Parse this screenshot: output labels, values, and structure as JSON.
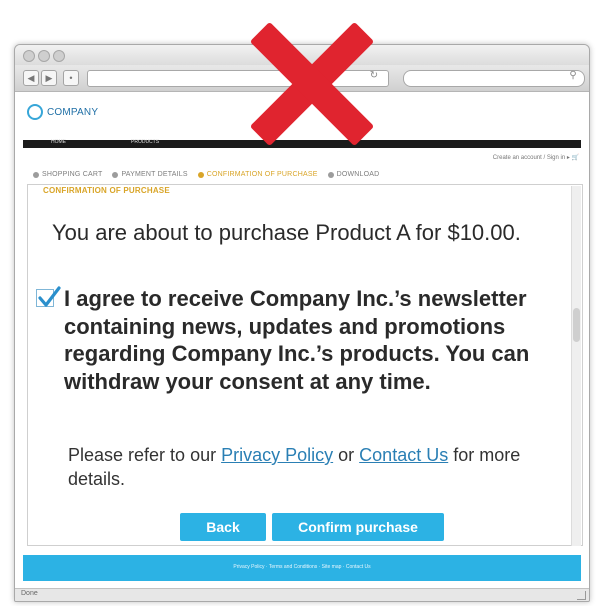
{
  "browser": {
    "status_text": "Done"
  },
  "site": {
    "logo_text": "COMPANY",
    "nav_items": [
      "HOME",
      "PRODUCTS"
    ],
    "account_links": "Create an account  /  Sign in  ▸",
    "steps": [
      {
        "label": "SHOPPING CART",
        "active": false
      },
      {
        "label": "PAYMENT DETAILS",
        "active": false
      },
      {
        "label": "CONFIRMATION OF PURCHASE",
        "active": true
      },
      {
        "label": "DOWNLOAD",
        "active": false
      }
    ]
  },
  "confirmation": {
    "heading": "CONFIRMATION OF PURCHASE",
    "purchase_text": "You are about to purchase Product A for $10.00.",
    "consent_checked": true,
    "consent_text": "I agree to receive Company Inc.’s newsletter containing news, updates and promotions regarding Company Inc.’s products. You can withdraw your consent at any time.",
    "refer_prefix": "Please refer to our",
    "privacy_link": "Privacy Policy",
    "refer_or": "or",
    "contact_link": "Contact Us",
    "refer_suffix": "for more details.",
    "back_label": "Back",
    "confirm_label": "Confirm purchase"
  },
  "footer": {
    "links": "Privacy Policy  ·  Terms and Conditions  ·  Site map  ·  Contact Us"
  },
  "overlay": {
    "icon": "red-x-icon",
    "color": "#e0242f"
  },
  "colors": {
    "accent": "#2cb2e4",
    "step_active": "#d9a528",
    "nav_bg": "#1b1b1b"
  }
}
